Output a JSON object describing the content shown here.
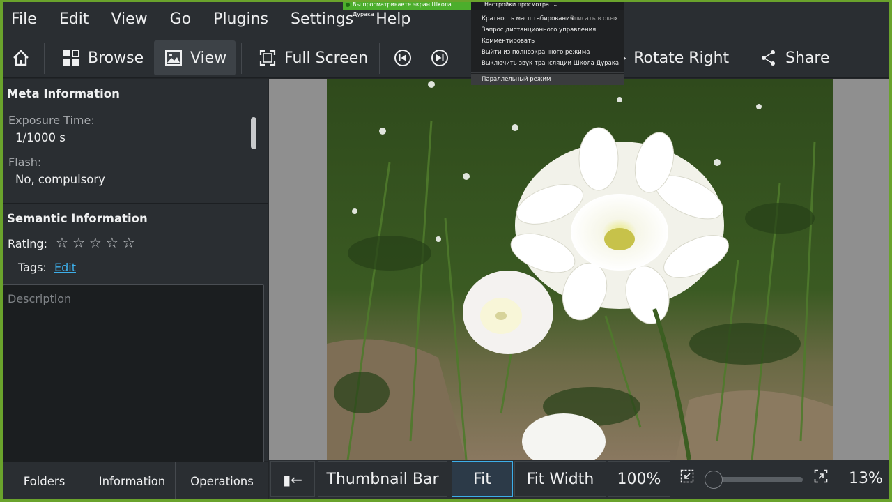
{
  "menubar": {
    "items": [
      "File",
      "Edit",
      "View",
      "Go",
      "Plugins",
      "Settings",
      "Help"
    ]
  },
  "share_banner": {
    "text": "Вы просматриваете экран Школа Дурака"
  },
  "view_settings": {
    "label": "Настройки просмотра",
    "chevron": "⌄"
  },
  "dropdown": {
    "items": [
      {
        "label": "Кратность масштабирования",
        "sub": "Вписать в окно",
        "arrow": "›"
      },
      {
        "label": "Запрос дистанционного управления"
      },
      {
        "label": "Комментировать"
      },
      {
        "label": "Выйти из полноэкранного режима"
      },
      {
        "label": "Выключить звук трансляции Школа Дурака"
      }
    ],
    "highlighted": "Параллельный режим"
  },
  "toolbar": {
    "browse": "Browse",
    "view": "View",
    "fullscreen": "Full Screen",
    "rotate_right": "Rotate Right",
    "share": "Share"
  },
  "meta": {
    "title": "Meta Information",
    "exposure_label": "Exposure Time:",
    "exposure_value": "1/1000 s",
    "flash_label": "Flash:",
    "flash_value": "No, compulsory"
  },
  "semantic": {
    "title": "Semantic Information",
    "rating_label": "Rating:",
    "rating": 0,
    "rating_max": 5,
    "tags_label": "Tags:",
    "tags_edit": "Edit",
    "description_placeholder": "Description"
  },
  "left_tabs": [
    "Folders",
    "Information",
    "Operations"
  ],
  "bottombar": {
    "thumbnail_bar": "Thumbnail Bar",
    "fit": "Fit",
    "fit_width": "Fit Width",
    "zoom_100": "100%",
    "zoom_value": "13%",
    "zoom_fraction": 0.0
  },
  "colors": {
    "accent": "#3daee9",
    "frame": "#6aa32c"
  }
}
